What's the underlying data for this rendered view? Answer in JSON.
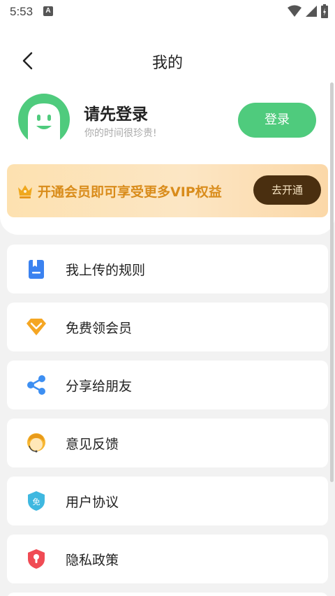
{
  "status_bar": {
    "time": "5:53",
    "notif_letter": "A"
  },
  "nav": {
    "title": "我的"
  },
  "profile": {
    "title": "请先登录",
    "subtitle": "你的时间很珍贵!",
    "login_label": "登录"
  },
  "vip": {
    "text": "开通会员即可享受更多VIP权益",
    "button_label": "去开通"
  },
  "menu": {
    "items": [
      {
        "label": "我上传的规则",
        "icon": "book-icon",
        "color": "#3b82f0"
      },
      {
        "label": "免费领会员",
        "icon": "diamond-icon",
        "color": "#f5a623"
      },
      {
        "label": "分享给朋友",
        "icon": "share-icon",
        "color": "#3d8ff2"
      },
      {
        "label": "意见反馈",
        "icon": "customer-service-icon",
        "color": "#f7b733"
      },
      {
        "label": "用户协议",
        "icon": "shield-free-icon",
        "color": "#3fb8e0"
      },
      {
        "label": "隐私政策",
        "icon": "shield-lock-icon",
        "color": "#f04b54"
      }
    ]
  },
  "colors": {
    "accent": "#4fcb7d",
    "vip_text": "#d98c1b",
    "vip_button": "#4a2f10"
  }
}
